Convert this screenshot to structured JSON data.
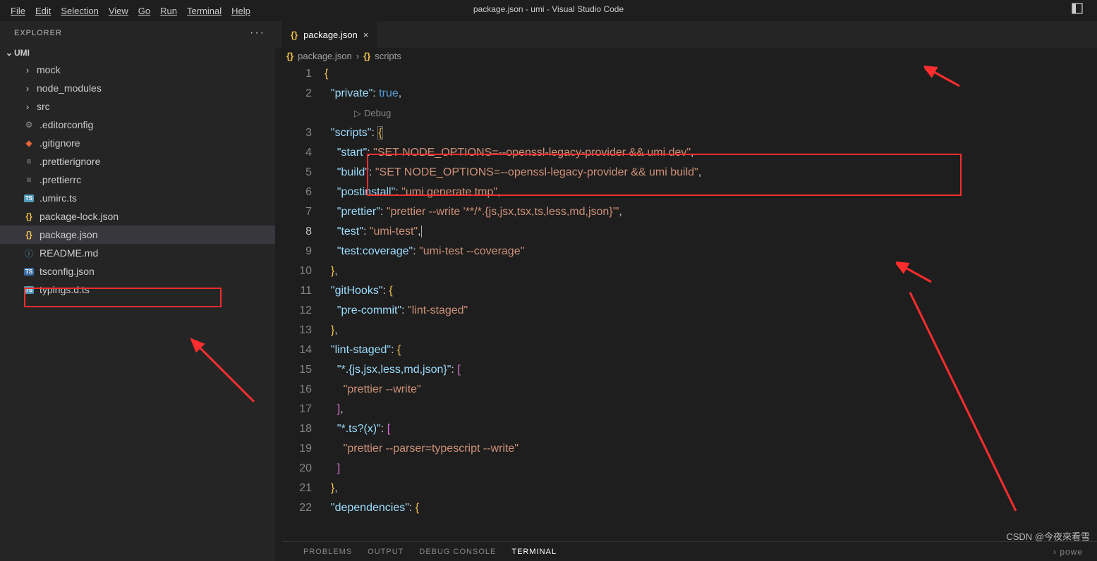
{
  "title": "package.json - umi - Visual Studio Code",
  "menu": {
    "file": "File",
    "edit": "Edit",
    "selection": "Selection",
    "view": "View",
    "go": "Go",
    "run": "Run",
    "terminal": "Terminal",
    "help": "Help"
  },
  "explorer": {
    "title": "EXPLORER",
    "project": "UMI"
  },
  "tree": {
    "folders": [
      "mock",
      "node_modules",
      "src"
    ],
    "files": [
      {
        "icon": "gear",
        "name": ".editorconfig"
      },
      {
        "icon": "gitignore",
        "name": ".gitignore"
      },
      {
        "icon": "lines",
        "name": ".prettierignore"
      },
      {
        "icon": "lines",
        "name": ".prettierrc"
      },
      {
        "icon": "ts",
        "name": ".umirc.ts"
      },
      {
        "icon": "braces",
        "name": "package-lock.json"
      },
      {
        "icon": "braces",
        "name": "package.json",
        "selected": true
      },
      {
        "icon": "info",
        "name": "README.md"
      },
      {
        "icon": "ts-blue",
        "name": "tsconfig.json"
      },
      {
        "icon": "ts",
        "name": "typings.d.ts"
      }
    ]
  },
  "tab": {
    "filename": "package.json"
  },
  "breadcrumb": {
    "file": "package.json",
    "section": "scripts"
  },
  "debug_lens": "Debug",
  "code": {
    "lines": [
      {
        "n": 1,
        "ind": 0,
        "parts": [
          {
            "t": "{",
            "c": "brace"
          }
        ]
      },
      {
        "n": 2,
        "ind": 1,
        "parts": [
          {
            "t": "\"private\"",
            "c": "key"
          },
          {
            "t": ": ",
            "c": "colon"
          },
          {
            "t": "true",
            "c": "bool"
          },
          {
            "t": ",",
            "c": "punc"
          }
        ]
      },
      {
        "n": 3,
        "ind": 1,
        "parts": [
          {
            "t": "\"scripts\"",
            "c": "key"
          },
          {
            "t": ": ",
            "c": "colon"
          },
          {
            "t": "{",
            "c": "brace",
            "boxed": true
          }
        ]
      },
      {
        "n": 4,
        "ind": 2,
        "parts": [
          {
            "t": "\"start\"",
            "c": "key"
          },
          {
            "t": ": ",
            "c": "colon"
          },
          {
            "t": "\"SET NODE_OPTIONS=--openssl-legacy-provider && umi dev\"",
            "c": "string"
          },
          {
            "t": ",",
            "c": "punc"
          }
        ]
      },
      {
        "n": 5,
        "ind": 2,
        "parts": [
          {
            "t": "\"build\"",
            "c": "key"
          },
          {
            "t": ": ",
            "c": "colon"
          },
          {
            "t": "\"SET NODE_OPTIONS=--openssl-legacy-provider && umi build\"",
            "c": "string"
          },
          {
            "t": ",",
            "c": "punc"
          }
        ]
      },
      {
        "n": 6,
        "ind": 2,
        "parts": [
          {
            "t": "\"postinstall\"",
            "c": "key"
          },
          {
            "t": ": ",
            "c": "colon"
          },
          {
            "t": "\"umi generate tmp\"",
            "c": "string"
          },
          {
            "t": ",",
            "c": "punc"
          }
        ]
      },
      {
        "n": 7,
        "ind": 2,
        "parts": [
          {
            "t": "\"prettier\"",
            "c": "key"
          },
          {
            "t": ": ",
            "c": "colon"
          },
          {
            "t": "\"prettier --write '**/*.{js,jsx,tsx,ts,less,md,json}'\"",
            "c": "string"
          },
          {
            "t": ",",
            "c": "punc"
          }
        ]
      },
      {
        "n": 8,
        "ind": 2,
        "current": true,
        "parts": [
          {
            "t": "\"test\"",
            "c": "key"
          },
          {
            "t": ": ",
            "c": "colon"
          },
          {
            "t": "\"umi-test\"",
            "c": "string"
          },
          {
            "t": ",",
            "c": "punc",
            "cursor": true
          }
        ]
      },
      {
        "n": 9,
        "ind": 2,
        "parts": [
          {
            "t": "\"test:coverage\"",
            "c": "key"
          },
          {
            "t": ": ",
            "c": "colon"
          },
          {
            "t": "\"umi-test --coverage\"",
            "c": "string"
          }
        ]
      },
      {
        "n": 10,
        "ind": 1,
        "parts": [
          {
            "t": "}",
            "c": "brace"
          },
          {
            "t": ",",
            "c": "punc"
          }
        ]
      },
      {
        "n": 11,
        "ind": 1,
        "parts": [
          {
            "t": "\"gitHooks\"",
            "c": "key"
          },
          {
            "t": ": ",
            "c": "colon"
          },
          {
            "t": "{",
            "c": "brace"
          }
        ]
      },
      {
        "n": 12,
        "ind": 2,
        "parts": [
          {
            "t": "\"pre-commit\"",
            "c": "key"
          },
          {
            "t": ": ",
            "c": "colon"
          },
          {
            "t": "\"lint-staged\"",
            "c": "string"
          }
        ]
      },
      {
        "n": 13,
        "ind": 1,
        "parts": [
          {
            "t": "}",
            "c": "brace"
          },
          {
            "t": ",",
            "c": "punc"
          }
        ]
      },
      {
        "n": 14,
        "ind": 1,
        "parts": [
          {
            "t": "\"lint-staged\"",
            "c": "key"
          },
          {
            "t": ": ",
            "c": "colon"
          },
          {
            "t": "{",
            "c": "brace"
          }
        ]
      },
      {
        "n": 15,
        "ind": 2,
        "parts": [
          {
            "t": "\"*.{js,jsx,less,md,json}\"",
            "c": "key"
          },
          {
            "t": ": ",
            "c": "colon"
          },
          {
            "t": "[",
            "c": "bracket"
          }
        ]
      },
      {
        "n": 16,
        "ind": 3,
        "parts": [
          {
            "t": "\"prettier --write\"",
            "c": "string"
          }
        ]
      },
      {
        "n": 17,
        "ind": 2,
        "parts": [
          {
            "t": "]",
            "c": "bracket"
          },
          {
            "t": ",",
            "c": "punc"
          }
        ]
      },
      {
        "n": 18,
        "ind": 2,
        "parts": [
          {
            "t": "\"*.ts?(x)\"",
            "c": "key"
          },
          {
            "t": ": ",
            "c": "colon"
          },
          {
            "t": "[",
            "c": "bracket"
          }
        ]
      },
      {
        "n": 19,
        "ind": 3,
        "parts": [
          {
            "t": "\"prettier --parser=typescript --write\"",
            "c": "string"
          }
        ]
      },
      {
        "n": 20,
        "ind": 2,
        "parts": [
          {
            "t": "]",
            "c": "bracket"
          }
        ]
      },
      {
        "n": 21,
        "ind": 1,
        "parts": [
          {
            "t": "}",
            "c": "brace"
          },
          {
            "t": ",",
            "c": "punc"
          }
        ]
      },
      {
        "n": 22,
        "ind": 1,
        "parts": [
          {
            "t": "\"dependencies\"",
            "c": "key"
          },
          {
            "t": ": ",
            "c": "colon"
          },
          {
            "t": "{",
            "c": "brace"
          }
        ]
      }
    ]
  },
  "panel": {
    "problems": "PROBLEMS",
    "output": "OUTPUT",
    "debug": "DEBUG CONSOLE",
    "terminal": "TERMINAL",
    "powershell": "powe"
  },
  "watermark": "CSDN @今夜來看雪"
}
